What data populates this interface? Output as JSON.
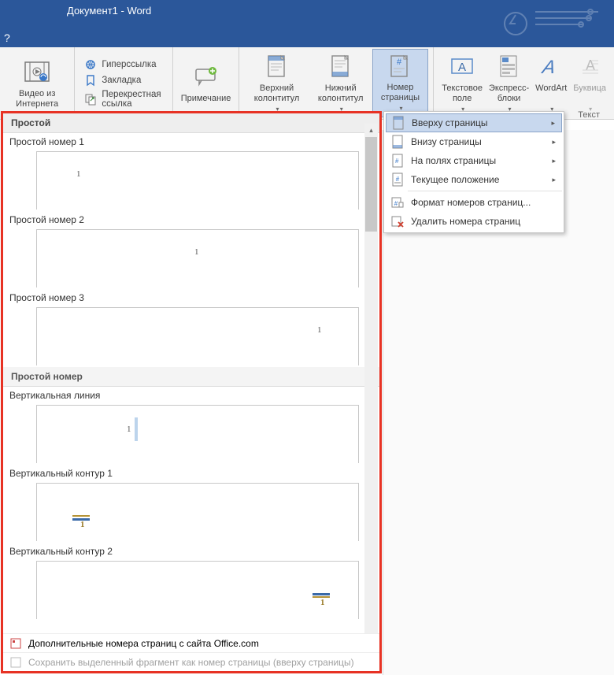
{
  "title": "Документ1 - Word",
  "ribbon": {
    "video": {
      "label": "Видео из Интернета"
    },
    "links": {
      "hyperlink": "Гиперссылка",
      "bookmark": "Закладка",
      "crossref": "Перекрестная ссылка"
    },
    "comment": {
      "label": "Примечание"
    },
    "header": {
      "label": "Верхний колонтитул"
    },
    "footer": {
      "label": "Нижний колонтитул"
    },
    "pagenum": {
      "label": "Номер страницы"
    },
    "textbox": {
      "label": "Текстовое поле"
    },
    "quickparts": {
      "label": "Экспресс-блоки"
    },
    "wordart": {
      "label": "WordArt"
    },
    "dropcap": {
      "label": "Буквица"
    },
    "text_group": "Текст"
  },
  "dropdown": {
    "top": "Вверху страницы",
    "bottom": "Внизу страницы",
    "margins": "На полях страницы",
    "current": "Текущее положение",
    "format": "Формат номеров страниц...",
    "remove": "Удалить номера страниц"
  },
  "gallery": {
    "group_plain": "Простой",
    "items_plain": [
      {
        "title": "Простой номер 1",
        "num": "1",
        "pos": "left"
      },
      {
        "title": "Простой номер 2",
        "num": "1",
        "pos": "center"
      },
      {
        "title": "Простой номер 3",
        "num": "1",
        "pos": "right"
      }
    ],
    "group_plainnum": "Простой номер",
    "item_vline": {
      "title": "Вертикальная линия",
      "num": "1"
    },
    "item_vcontour1": {
      "title": "Вертикальный контур 1",
      "num": "1"
    },
    "item_vcontour2": {
      "title": "Вертикальный контур 2",
      "num": "1"
    },
    "footer_more": "Дополнительные номера страниц с сайта Office.com",
    "footer_save": "Сохранить выделенный фрагмент как номер страницы (вверху страницы)"
  }
}
